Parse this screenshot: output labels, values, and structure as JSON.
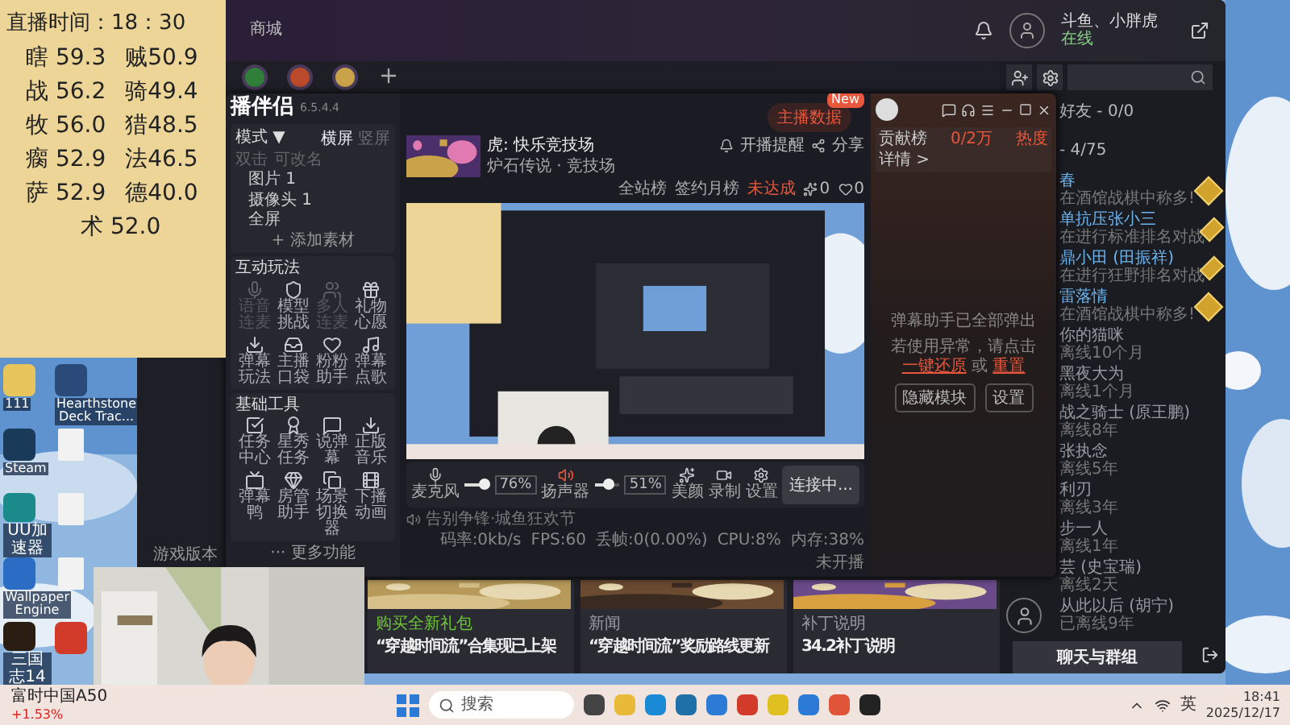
{
  "overlay_note": {
    "title": "直播时间：18：30",
    "rows": [
      [
        "瞎 59.3",
        "贼50.9"
      ],
      [
        "战 56.2",
        "骑49.4"
      ],
      [
        "牧 56.0",
        "猎48.5"
      ],
      [
        "瘸 52.9",
        "法46.5"
      ],
      [
        "萨 52.9",
        "德40.0"
      ]
    ],
    "last": "术 52.0"
  },
  "desktop_icons": [
    {
      "kind": "app",
      "label": "111"
    },
    {
      "kind": "app",
      "label": "Hearthstone Deck Trac..."
    },
    {
      "kind": "app",
      "label": "Steam"
    },
    {
      "kind": "file"
    },
    {
      "kind": "app",
      "label": "UU加速器"
    },
    {
      "kind": "file"
    },
    {
      "kind": "app",
      "label": "Wallpaper Engine"
    },
    {
      "kind": "file"
    },
    {
      "kind": "app",
      "label": "三国志14"
    },
    {
      "kind": "app"
    }
  ],
  "launcher": {
    "nav": "商城",
    "user": {
      "name": "斗鱼、小胖虎",
      "status": "在线"
    },
    "version_label": "游戏版本",
    "friends": {
      "header": "好友 - 0/0",
      "subheader": "- 4/75",
      "items": [
        {
          "name": "春",
          "status": "在酒馆战棋中称多!",
          "online": true,
          "kind": "plain"
        },
        {
          "name": "单抗压张小三",
          "status": "在进行标准排名对战",
          "online": true,
          "kind": "plain"
        },
        {
          "name": "鼎小田 (田振祥)",
          "status": "在进行狂野排名对战",
          "online": true,
          "kind": "plain"
        },
        {
          "name": "雷落情",
          "status": "在酒馆战棋中称多!",
          "online": true,
          "kind": "plain"
        },
        {
          "name": "你的猫咪",
          "status": "离线10个月",
          "online": false,
          "kind": "plain"
        },
        {
          "name": "黑夜大为",
          "status": "离线1个月",
          "online": false,
          "kind": "plain"
        },
        {
          "name": "战之骑士 (原王鹏)",
          "status": "离线8年",
          "online": false,
          "kind": "plain"
        },
        {
          "name": "张执念",
          "status": "离线5年",
          "online": false,
          "kind": "plain"
        },
        {
          "name": "利刃",
          "status": "离线3年",
          "online": false,
          "kind": "plain"
        },
        {
          "name": "步一人",
          "status": "离线1年",
          "online": false,
          "kind": "plain"
        },
        {
          "name": "芸 (史宝瑞)",
          "status": "离线2天",
          "online": false,
          "kind": "plain"
        },
        {
          "name": "从此以后 (胡宁)",
          "status": "已离线9年",
          "online": false,
          "kind": "avatar"
        }
      ],
      "chat_button": "聊天与群组"
    },
    "news": [
      {
        "tag": "购买全新礼包",
        "title": "“穿越时间流”合集现已上架",
        "color": "#6ec23a"
      },
      {
        "tag": "新闻",
        "title": "“穿越时间流”奖励路线更新",
        "color": "#9a9aa2"
      },
      {
        "tag": "补丁说明",
        "title": "34.2补丁说明",
        "color": "#9a9aa2"
      }
    ]
  },
  "streamer": {
    "logo": "播伴侣",
    "version": "6.5.4.4",
    "mode": "模式 ▼",
    "orientations": [
      {
        "label": "横屏",
        "selected": true
      },
      {
        "label": "竖屏",
        "selected": false
      }
    ],
    "scene_hints": [
      "双击",
      "可改名"
    ],
    "sources": [
      "图片 1",
      "摄像头 1",
      "全屏"
    ],
    "add_source": "+ 添加素材",
    "interactive": {
      "title": "互动玩法",
      "items": [
        {
          "label": "语音连麦",
          "disabled": true
        },
        {
          "label": "模型挑战",
          "disabled": false
        },
        {
          "label": "多人连麦",
          "disabled": true
        },
        {
          "label": "礼物心愿",
          "disabled": false
        },
        {
          "label": "弹幕玩法",
          "disabled": false
        },
        {
          "label": "主播口袋",
          "disabled": false
        },
        {
          "label": "粉粉助手",
          "disabled": false
        },
        {
          "label": "弹幕点歌",
          "disabled": false
        }
      ]
    },
    "basic": {
      "title": "基础工具",
      "items": [
        {
          "label": "任务中心",
          "disabled": false
        },
        {
          "label": "星秀任务",
          "disabled": false
        },
        {
          "label": "说弹幕",
          "disabled": false
        },
        {
          "label": "正版音乐",
          "disabled": false
        },
        {
          "label": "弹幕鸭",
          "disabled": false
        },
        {
          "label": "房管助手",
          "disabled": false
        },
        {
          "label": "场景切换器",
          "disabled": false
        },
        {
          "label": "下播动画",
          "disabled": false
        }
      ]
    },
    "more": "··· 更多功能",
    "data_button": "主播数据",
    "new_badge": "New",
    "room_title": "虎: 快乐竞技场",
    "category": "炉石传说 · 竞技场",
    "remind": "开播提醒",
    "share": "分享",
    "ranks": [
      {
        "label": "全站榜"
      },
      {
        "label": "签约月榜"
      }
    ],
    "rank_status": "未达成",
    "counts": [
      "0",
      "0"
    ],
    "audio": [
      {
        "label": "麦克风",
        "level": 0.76,
        "reading": "76%"
      },
      {
        "label": "扬声器",
        "level": 0.51,
        "reading": "51%"
      }
    ],
    "actions": [
      "美颜",
      "录制",
      "设置"
    ],
    "connect": "连接中...",
    "notice": "告别争锋·城鱼狂欢节",
    "stats": [
      "码率:0kb/s",
      "FPS:60",
      "丢帧:0(0.00%)",
      "CPU:8%",
      "内存:38%",
      "未开播"
    ],
    "chat": {
      "rank": "贡献榜",
      "rank_value": "0/2万",
      "heat": "热度",
      "details": "详情 >",
      "notice": "弹幕助手已全部弹出",
      "hint": "若使用异常，请点击",
      "restore": "一键还原",
      "or": "或",
      "reset": "重置",
      "buttons": [
        "隐藏模块",
        "设置"
      ]
    }
  },
  "taskbar": {
    "stock": {
      "name": "富时中国A50",
      "change": "+1.53%"
    },
    "search": "搜索",
    "ime": "英",
    "time": "18:41",
    "date": "2025/12/17"
  }
}
